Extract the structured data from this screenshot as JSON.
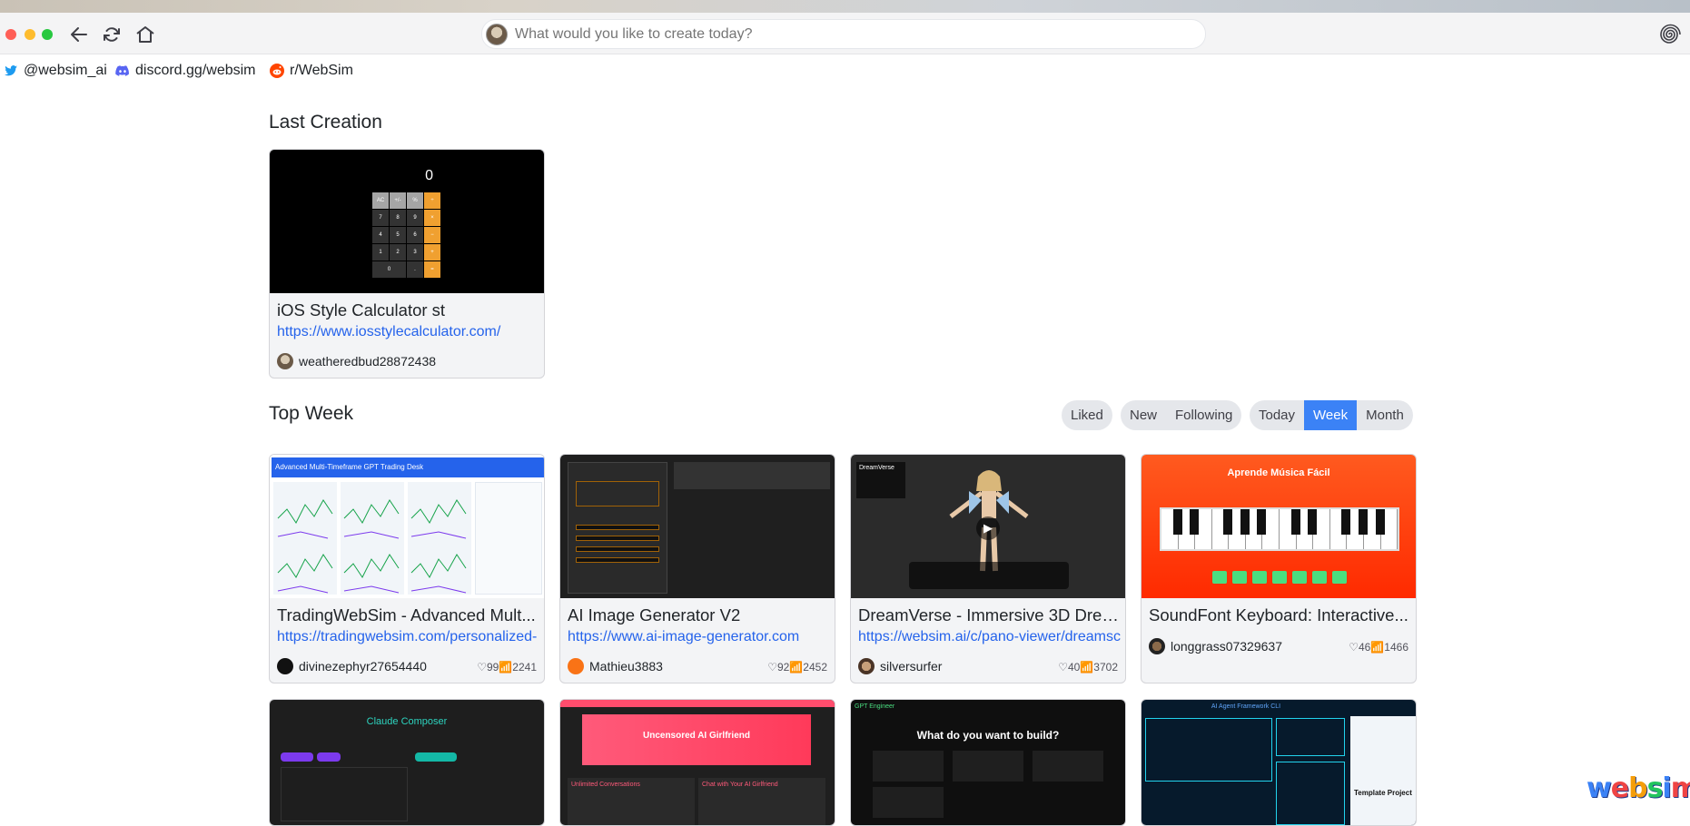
{
  "browser": {
    "address_placeholder": "What would you like to create today?"
  },
  "social": {
    "twitter": "@websim_ai",
    "discord": "discord.gg/websim",
    "reddit": "r/WebSim"
  },
  "last_creation": {
    "heading": "Last Creation",
    "card": {
      "title": "iOS Style Calculator st",
      "link": "https://www.iosstylecalculator.com/",
      "author": "weatheredbud28872438",
      "display": "0",
      "keys": [
        "AC",
        "+/-",
        "%",
        "÷",
        "7",
        "8",
        "9",
        "×",
        "4",
        "5",
        "6",
        "−",
        "1",
        "2",
        "3",
        "+",
        "0",
        ".",
        "="
      ]
    }
  },
  "top_week": {
    "heading": "Top Week",
    "filters_a": [
      "Liked"
    ],
    "filters_b": [
      "New",
      "Following"
    ],
    "filters_c": [
      "Today",
      "Week",
      "Month"
    ],
    "active_filter": "Week",
    "cards": [
      {
        "title": "TradingWebSim - Advanced Mult...",
        "link": "https://tradingwebsim.com/personalized-",
        "author": "divinezephyr27654440",
        "likes": "99",
        "views": "2241",
        "thumb_title": "Advanced Multi-Timeframe GPT Trading Desk"
      },
      {
        "title": "AI Image Generator V2",
        "link": "https://www.ai-image-generator.com",
        "author": "Mathieu3883",
        "likes": "92",
        "views": "2452"
      },
      {
        "title": "DreamVerse - Immersive 3D Drea...",
        "link": "https://websim.ai/c/pano-viewer/dreamsc",
        "author": "silversurfer",
        "likes": "40",
        "views": "3702",
        "thumb_title": "DreamVerse"
      },
      {
        "title": "SoundFont Keyboard: Interactive...",
        "link": "",
        "author": "longgrass07329637",
        "likes": "46",
        "views": "1466",
        "thumb_title": "Aprende Música Fácil"
      }
    ],
    "row2": [
      {
        "thumb_title": "Claude Composer"
      },
      {
        "thumb_title": "Uncensored AI Girlfriend",
        "thumb_sub": "Unlimited Conversations",
        "thumb_side": "Chat with Your AI Girlfriend"
      },
      {
        "thumb_title": "What do you want to build?",
        "thumb_brand": "GPT Engineer"
      },
      {
        "thumb_title": "AI Agent Framework CLI",
        "thumb_side": "Template Project"
      }
    ]
  },
  "brand": {
    "logo_text": "websim"
  },
  "colors": {
    "accent": "#3b82f6",
    "link": "#2563eb"
  }
}
